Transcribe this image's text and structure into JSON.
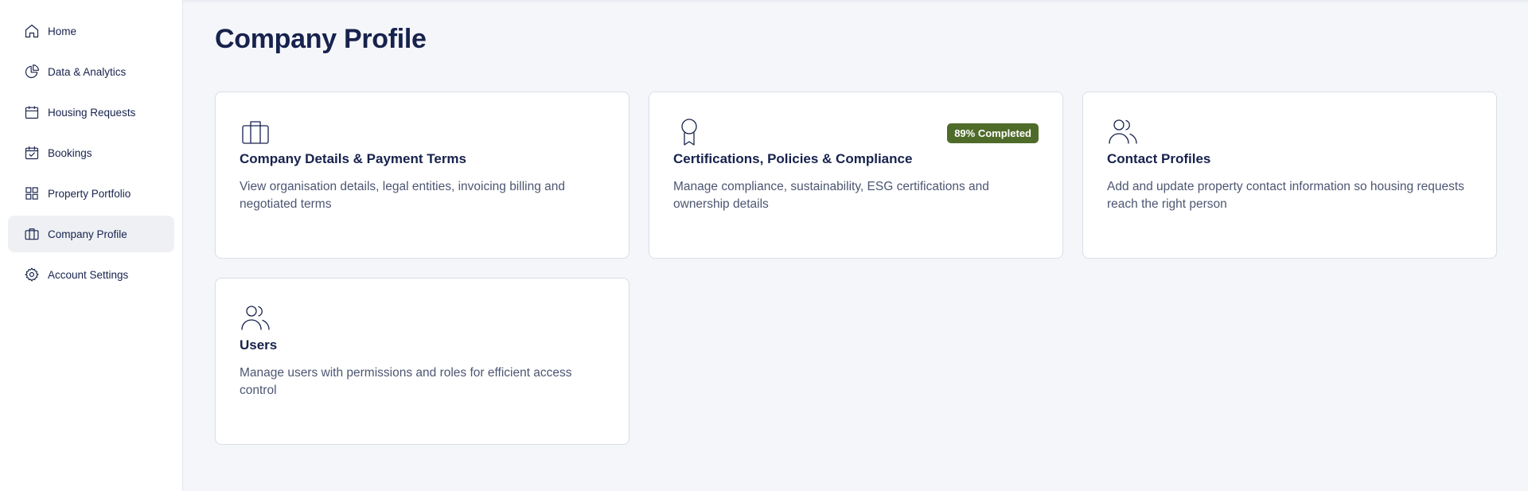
{
  "sidebar": {
    "items": [
      {
        "label": "Home",
        "icon": "home-icon"
      },
      {
        "label": "Data & Analytics",
        "icon": "pie-chart-icon"
      },
      {
        "label": "Housing Requests",
        "icon": "calendar-icon"
      },
      {
        "label": "Bookings",
        "icon": "calendar-check-icon"
      },
      {
        "label": "Property Portfolio",
        "icon": "grid-icon"
      },
      {
        "label": "Company Profile",
        "icon": "briefcase-icon",
        "active": true
      },
      {
        "label": "Account Settings",
        "icon": "gear-icon"
      }
    ]
  },
  "main": {
    "title": "Company Profile",
    "cards": [
      {
        "title": "Company Details & Payment Terms",
        "description": "View organisation details, legal entities, invoicing billing and negotiated terms",
        "icon": "briefcase-icon"
      },
      {
        "title": "Certifications, Policies & Compliance",
        "description": "Manage compliance, sustainability, ESG certifications and ownership details",
        "icon": "award-icon",
        "badge": "89% Completed"
      },
      {
        "title": "Contact Profiles",
        "description": "Add and update property contact information so housing requests reach the right person",
        "icon": "users-icon"
      },
      {
        "title": "Users",
        "description": "Manage users with permissions and roles for efficient access control",
        "icon": "users-icon"
      }
    ]
  },
  "colors": {
    "text_primary": "#17224d",
    "text_secondary": "#4d5672",
    "background": "#f4f6fa",
    "badge": "#4f6b2a",
    "active_nav": "#eef0f4"
  }
}
